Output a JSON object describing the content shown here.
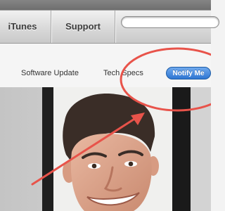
{
  "nav": {
    "itunes_label": "iTunes",
    "support_label": "Support",
    "search_placeholder": ""
  },
  "subnav": {
    "software_update_label": "Software Update",
    "tech_specs_label": "Tech Specs",
    "notify_label": "Notify Me"
  },
  "colors": {
    "annotation": "#e8534a",
    "notify_button": "#2f76d2",
    "nav_text": "#3c3c3c"
  },
  "icons": {
    "annotation_circle": "annotation-circle-icon",
    "annotation_arrow": "annotation-arrow-icon"
  }
}
